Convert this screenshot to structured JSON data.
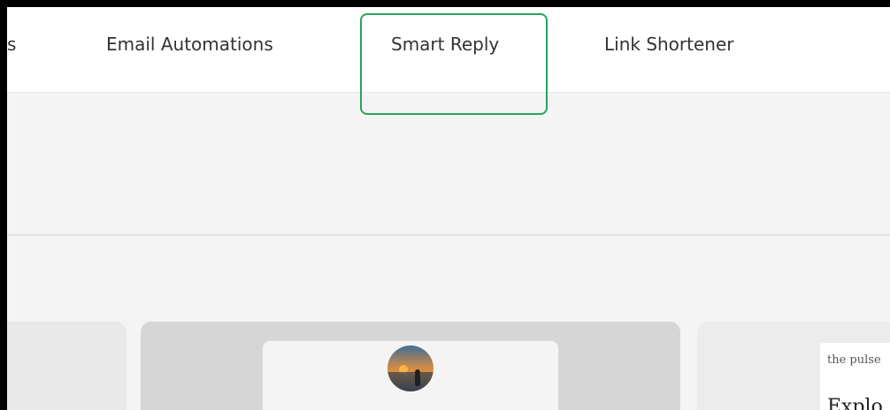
{
  "nav": {
    "tabs": [
      {
        "label": "s"
      },
      {
        "label": "Email Automations"
      },
      {
        "label": "Smart Reply"
      },
      {
        "label": "Link Shortener"
      }
    ],
    "highlighted_tab": "Smart Reply",
    "highlight_color": "#29a35a"
  },
  "preview": {
    "kicker": "the pulse",
    "title": "Explo"
  },
  "colors": {
    "page_background": "#f4f4f4",
    "nav_background": "#ffffff",
    "text": "#333333"
  }
}
